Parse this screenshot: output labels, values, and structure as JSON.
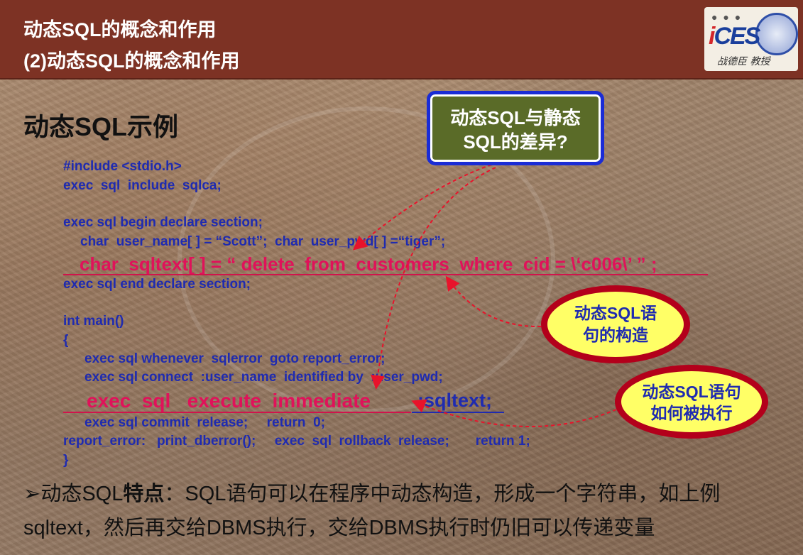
{
  "header": {
    "line1": "动态SQL的概念和作用",
    "line2": "(2)动态SQL的概念和作用"
  },
  "logo": {
    "brand": "iCES",
    "author": "战德臣 教授"
  },
  "section_title": "动态SQL示例",
  "code": {
    "l1": "#include <stdio.h>",
    "l2": "exec  sql  include  sqlca;",
    "l3": "exec sql begin declare section;",
    "l4": "char  user_name[ ] = “Scott”;  char  user_pwd[ ] =“tiger”;",
    "l5": "char  sqltext[ ] = “ delete  from  customers  where  cid = \\‘c006\\’ ” ;",
    "l6": "exec sql end declare section;",
    "l7": "int main()",
    "l8": "{",
    "l9": "exec sql whenever  sqlerror  goto report_error;",
    "l10": "exec sql connect  :user_name  identified by  :user_pwd;",
    "l11_red": "exec  sql   execute  immediate",
    "l11_blue": ":sqltext;",
    "l12": "exec sql commit  release;     return  0;",
    "l13": "report_error:   print_dberror();     exec  sql  rollback  release;       return 1;",
    "l14": "}"
  },
  "callouts": {
    "question_line1": "动态SQL与静态",
    "question_line2": "SQL的差异?",
    "oval1_line1": "动态SQL语",
    "oval1_line2": "句的构造",
    "oval2_line1": "动态SQL语句",
    "oval2_line2": "如何被执行"
  },
  "bottom": {
    "bullet": "➢",
    "prefix": "动态SQL",
    "bold": "特点",
    "rest": "：SQL语句可以在程序中动态构造，形成一个字符串，如上例",
    "line2": "sqltext，然后再交给DBMS执行，交给DBMS执行时仍旧可以传递变量"
  },
  "colors": {
    "header_bg": "#7d3224",
    "code_blue": "#1f2bb0",
    "code_red": "#e0125a",
    "callout_green": "#5a6b28",
    "oval_yellow": "#ffff66",
    "oval_border": "#b3001b"
  }
}
